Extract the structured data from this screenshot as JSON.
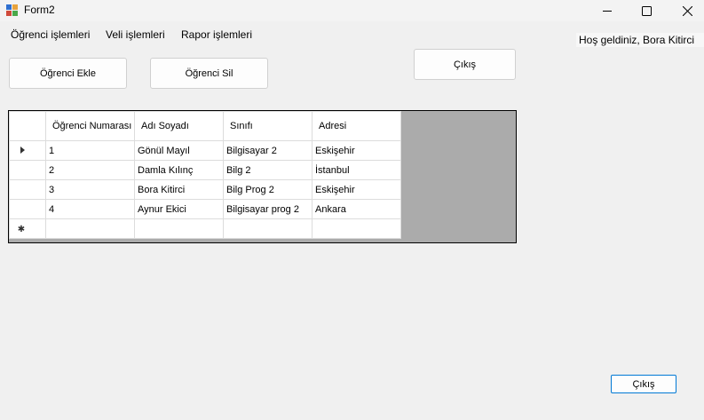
{
  "window": {
    "title": "Form2",
    "minimize_icon": "minimize-icon",
    "maximize_icon": "maximize-icon",
    "close_icon": "close-icon"
  },
  "menu": {
    "items": [
      {
        "label": "Öğrenci işlemleri"
      },
      {
        "label": "Veli işlemleri"
      },
      {
        "label": "Rapor işlemleri"
      }
    ]
  },
  "welcome_label": "Hoş geldiniz, Bora Kitirci",
  "buttons": {
    "add_student": "Öğrenci Ekle",
    "delete_student": "Öğrenci Sil",
    "exit_top": "Çıkış",
    "exit_bottom": "Çıkış"
  },
  "grid": {
    "columns": [
      "Öğrenci Numarası",
      "Adı Soyadı",
      "Sınıfı",
      "Adresi"
    ],
    "rows": [
      {
        "no": "1",
        "name": "Gönül Mayıl",
        "class": "Bilgisayar 2",
        "address": "Eskişehir"
      },
      {
        "no": "2",
        "name": "Damla Kılınç",
        "class": "Bilg 2",
        "address": "İstanbul"
      },
      {
        "no": "3",
        "name": "Bora Kitirci",
        "class": "Bilg Prog 2",
        "address": "Eskişehir"
      },
      {
        "no": "4",
        "name": "Aynur Ekici",
        "class": "Bilgisayar prog 2",
        "address": "Ankara"
      }
    ],
    "current_row_icon": "row-pointer-icon",
    "new_row_icon": "new-row-star-icon"
  }
}
